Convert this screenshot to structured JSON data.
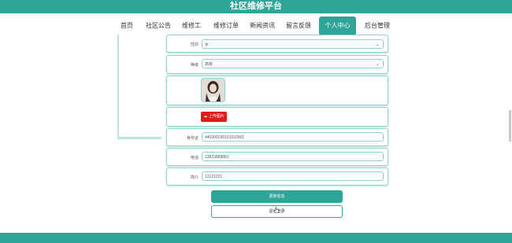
{
  "header": {
    "title": "社区维修平台"
  },
  "nav": {
    "items": [
      {
        "label": "首页"
      },
      {
        "label": "社区公告"
      },
      {
        "label": "维修工"
      },
      {
        "label": "维修订单"
      },
      {
        "label": "新闻资讯"
      },
      {
        "label": "留言反馈"
      },
      {
        "label": "个人中心",
        "active": true
      },
      {
        "label": "后台管理"
      }
    ]
  },
  "form": {
    "gender_label": "性别",
    "gender_value": "女",
    "grade_label": "等级",
    "grade_value": "高级",
    "upload_label": "上传图片",
    "id_label": "身份证",
    "id_value": "440300199101010001",
    "phone_label": "电话",
    "phone_value": "13823888881",
    "intro_label": "简介",
    "intro_value": "12121221"
  },
  "actions": {
    "update_label": "更新信息",
    "logout_label": "退出登录"
  },
  "colors": {
    "accent": "#2fa59a",
    "upload": "#e11a1a"
  }
}
